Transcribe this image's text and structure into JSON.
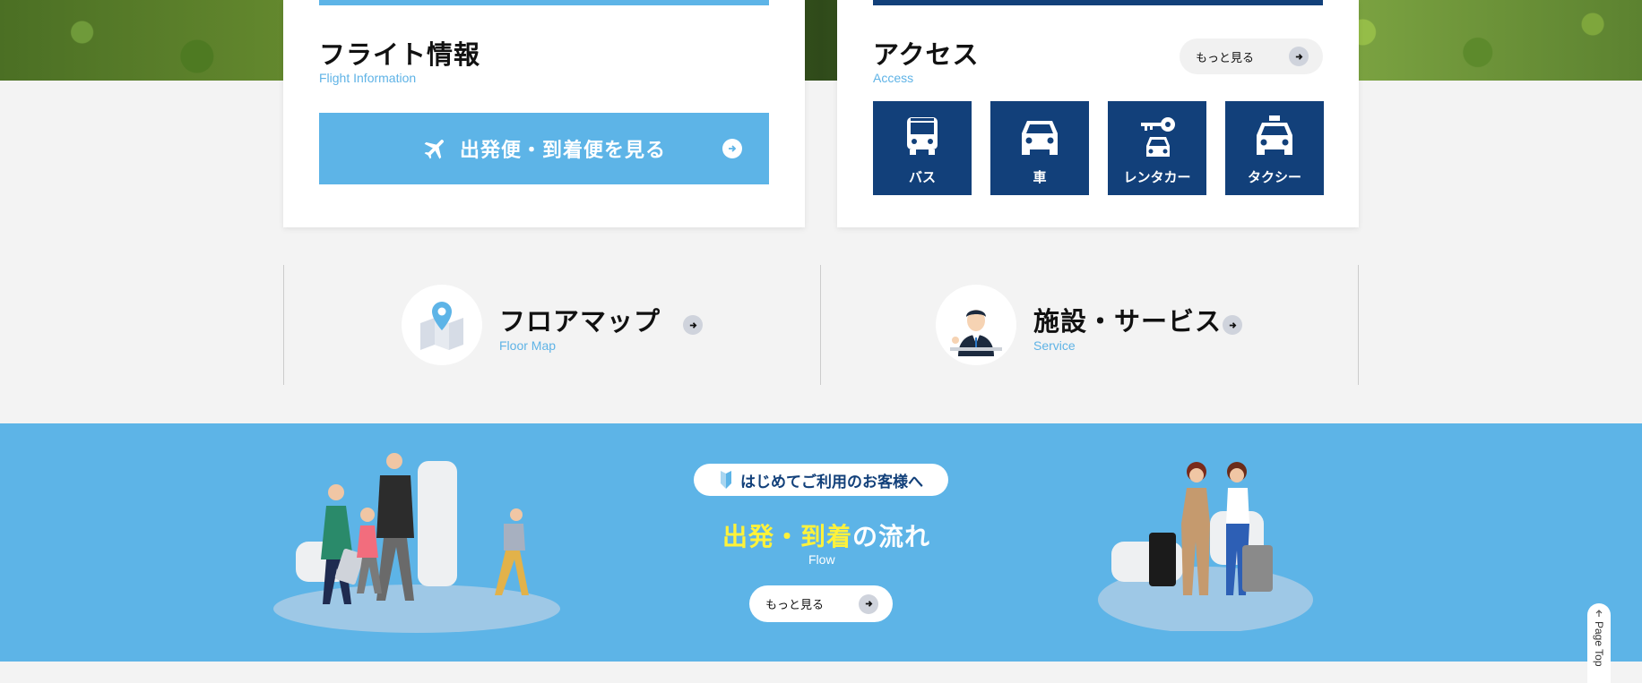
{
  "flight": {
    "title": "フライト情報",
    "subtitle": "Flight Information",
    "button_label": "出発便・到着便を見る"
  },
  "access": {
    "title": "アクセス",
    "subtitle": "Access",
    "more_label": "もっと見る",
    "tiles": [
      {
        "label": "バス",
        "icon": "bus-icon"
      },
      {
        "label": "車",
        "icon": "car-icon"
      },
      {
        "label": "レンタカー",
        "icon": "rental-car-key-icon"
      },
      {
        "label": "タクシー",
        "icon": "taxi-icon"
      }
    ]
  },
  "floor_map": {
    "title": "フロアマップ",
    "subtitle": "Floor Map"
  },
  "service": {
    "title": "施設・サービス",
    "subtitle": "Service"
  },
  "flow": {
    "pill_label": "はじめてご利用のお客様へ",
    "title_part1": "出発",
    "title_sep": "・",
    "title_part2": "到着",
    "title_part3": "の流れ",
    "subtitle": "Flow",
    "more_label": "もっと見る"
  },
  "page_top": {
    "label": "Page Top"
  },
  "colors": {
    "accent_blue": "#5db4e7",
    "navy": "#12407a",
    "highlight_yellow": "#fff23a"
  }
}
